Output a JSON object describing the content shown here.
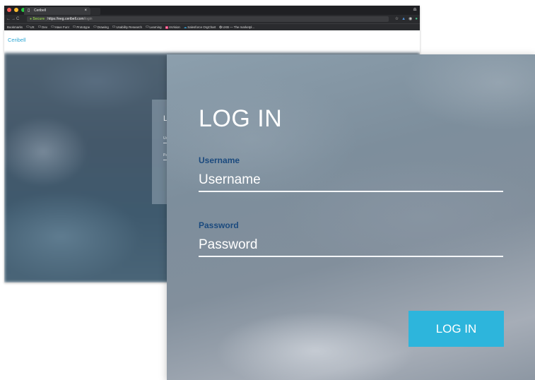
{
  "browser": {
    "tab_title": "Ceribell",
    "tab_favicon": "page-icon",
    "tab_close": "×",
    "address": {
      "secure_label": "Secure",
      "url_scheme": "https://",
      "url_host": "eeg.ceribell.com",
      "url_path": "/login"
    },
    "bookmarks": [
      {
        "label": "Bookmarks",
        "icon": ""
      },
      {
        "label": "UX",
        "icon": "folder-icon"
      },
      {
        "label": "Dev",
        "icon": "folder-icon"
      },
      {
        "label": "Have Fun!",
        "icon": "folder-icon"
      },
      {
        "label": "Prototype",
        "icon": "folder-icon"
      },
      {
        "label": "Drawing",
        "icon": "folder-icon"
      },
      {
        "label": "Usability Research",
        "icon": "folder-icon"
      },
      {
        "label": "Learning",
        "icon": "folder-icon"
      },
      {
        "label": "InVision",
        "icon": "invision-icon"
      },
      {
        "label": "Salesforce OrgChart",
        "icon": "salesforce-icon"
      },
      {
        "label": "UXB — The marketpl...",
        "icon": "uxb-icon"
      }
    ]
  },
  "site": {
    "brand": "Ceribell",
    "mini_login": {
      "title": "L",
      "username_label": "Us",
      "password_label": "Pa"
    }
  },
  "login": {
    "title": "LOG IN",
    "username_label": "Username",
    "username_placeholder": "Username",
    "password_label": "Password",
    "password_placeholder": "Password",
    "button_label": "LOG IN"
  },
  "colors": {
    "accent": "#2db5dc",
    "label": "#1b4a7e",
    "brand": "#2fa7d4"
  }
}
